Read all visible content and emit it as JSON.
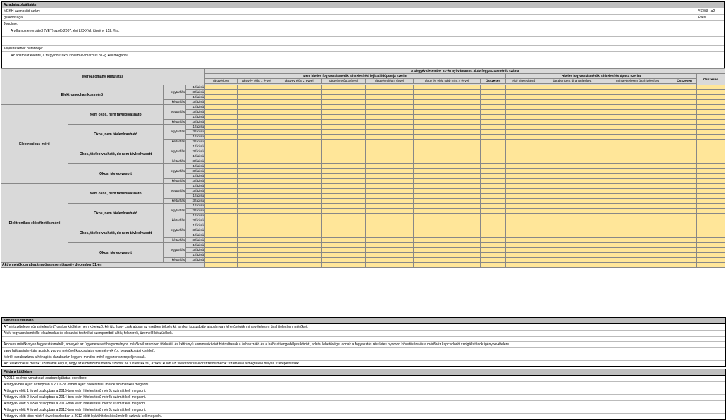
{
  "header": {
    "title": "Az adatszolgáltatás",
    "mekh_label": "MEKH azonosító szám:",
    "mekh_value": "VSW3 - a2",
    "period_label": "gyakorisága:",
    "period_value": "Éves",
    "legal_label": "Jogcíme:",
    "legal_text": "A villamos energiáról (VET) szóló 2007. évi LXXXVI. törvény 152. §-a.",
    "deadline_label": "Teljesítésének határideje:",
    "deadline_text": "Az adatokat évente, a tárgyidőszakot követő év március 31-ig kell megadni."
  },
  "table": {
    "title": "Mérőállomány kimutatás",
    "main_header": "A tárgyév december 31-én nyilvántartott aktív fogyasztásmérők száma",
    "group1": "Nem hiteles fogyasztásmérők a hitelesítési lejárati időpontja szerint",
    "group2": "Hiteles fogyasztásmérők a hitelesítés típusa szerint",
    "sum_col": "Összesen",
    "cols1": [
      "tárgyévben",
      "tárgyév előtt 1 évvel",
      "tárgyév előtt 2 évvel",
      "tárgyév előtt 3 évvel",
      "tárgyév előtt 4 évvel",
      "tárgy év előtt több mint 4 évvel",
      "Összesen"
    ],
    "cols2": [
      "első hitelesítésű",
      "darabonként újrahitelesített",
      "mintavételesen újrahitelesített",
      "Összesen"
    ],
    "tariff_one": "egytarifás",
    "tariff_two": "kéttarifás",
    "phase_one": "1 fázisú",
    "phase_three": "3 fázisú",
    "cat_em": "Elektromechanikus mérő",
    "cat_el": "Elektronikus mérő",
    "cat_pre": "Elektronikus előrefizetős mérő",
    "sub1": "Nem okos, nem távleolvasható",
    "sub2": "Okos, nem távleolvasható",
    "sub3": "Okos, távleolvasható, de nem távleolvasott",
    "sub4": "Okos, távleolvasott",
    "total_row": "Aktív mérők darabszáma összesen tárgyév december 31-én"
  },
  "instructions": {
    "title": "Kitöltési útmutató",
    "lines": [
      "A \"mintavételesen újrahitelesített\" oszlop kitöltése nem kötelező, kérjük, hogy csak abban az esetben töltsék ki, amikor jogszabály alapján van lehetőségük mintavételesen újrahitelesíteni mérőket.",
      "Aktív fogyasztásmérők: elszámolás és elosztási technikai szempontból aktív, felszerelt, üzemelő készülékek.",
      "Az okos mérők olyan fogyasztásmérők, amelyek az ügyenevezett hagyományos mérőknél szemben többcélú és kétirányú kommunikációt biztosítanak a felhasználó és a hálózati engedélyes között, adatai lehetőséget adnak a fogyasztás részletes nyomon követésére és a mérőhöz kapcsolódó szolgáltatások igénybevételére.",
      "vagy hálózatirányítási adatok, vagy a mérővel kapcsolatos események (pl. beavatkozási kísérlet).",
      "Mérők darabszáma a hónapiós darabszám legyen, minden mérő egyszer szerepeljen csak.",
      "Az \"elektronikus mérők\" számánál kérjük, hogy az előrefizetős mérők számát ne tüntessék fel, azokat külön az \"elektronikus előrefizetős mérők\" számánál a megfelelő helyen szerepeltessék."
    ]
  },
  "example": {
    "title": "Példa a kitöltésre",
    "lines": [
      "A 2016-os évre vonatkozó adatszolgáltatás esetében:",
      "A tárgyévben lejárt oszlopban a 2016-os évben lejárt hitelesítésű mérők számát kell megadni.",
      "A tárgyév előtt 1 évvel oszlopban a 2015-ben lejárt hitelesítésű mérők számát kell megadni.",
      "A tárgyév előtt 2 évvel oszlopban a 2014-ben lejárt hitelesítésű mérők számát kell megadni.",
      "A tárgyév előtt 3 évvel oszlopban a 2013-ban lejárt hitelesítésű mérők számát kell megadni.",
      "A tárgyév előtt 4 évvel oszlopban a 2012-ben lejárt hitelesítésű mérők számát kell megadni.",
      "A tárgyév előtt több mint 4 évvel oszlopban a 2012 előtt lejárt hitelesítésű mérők számát kell megadni."
    ]
  }
}
